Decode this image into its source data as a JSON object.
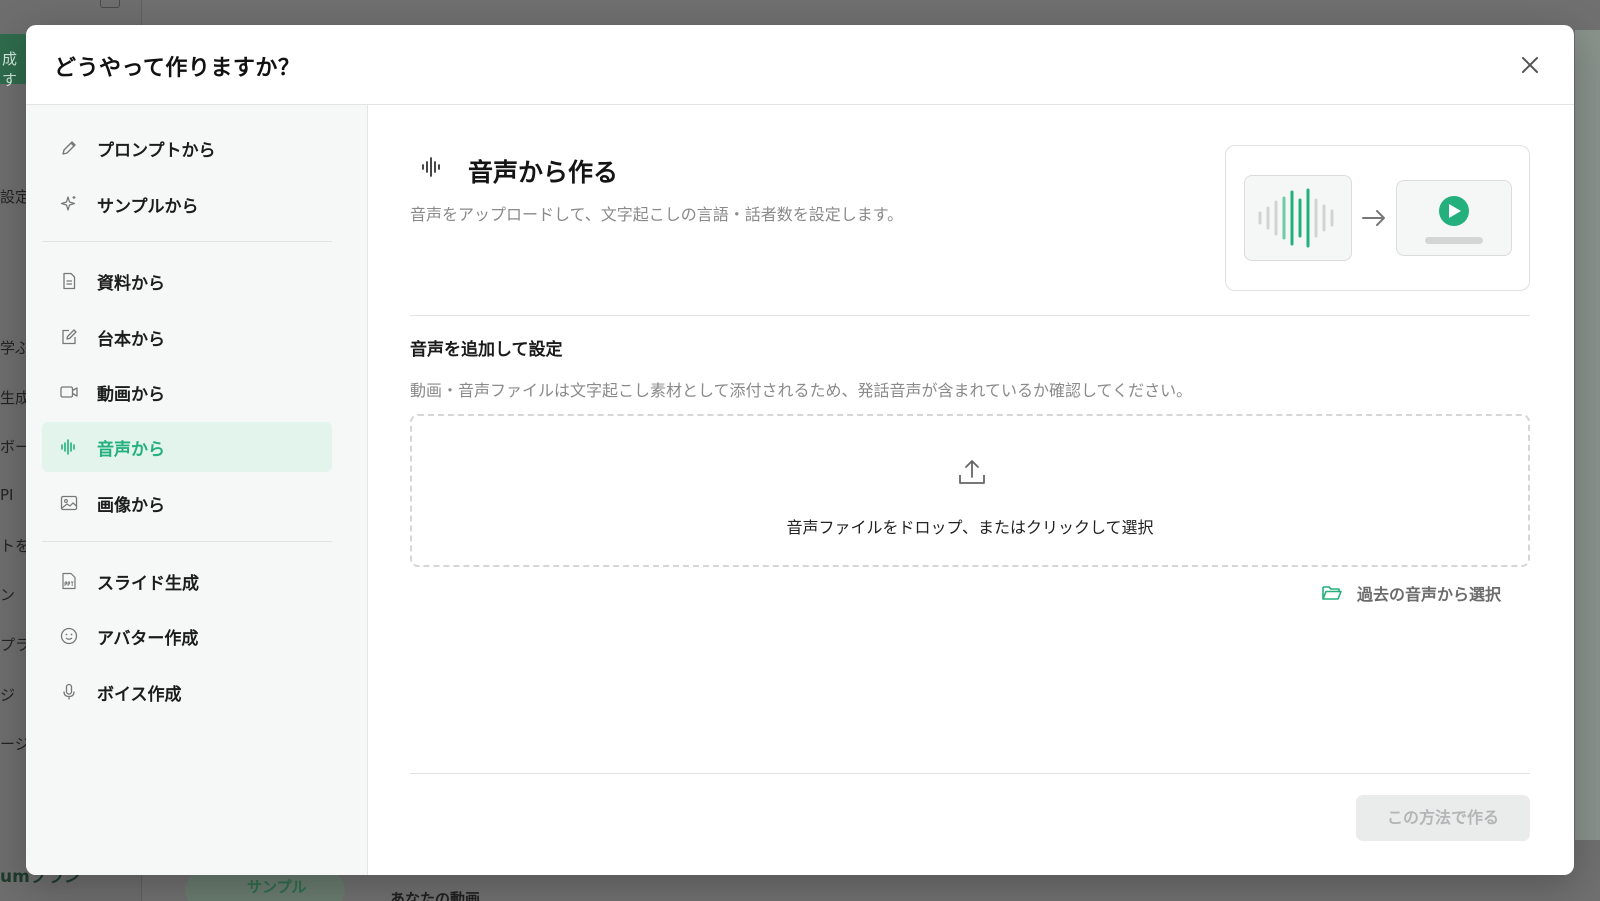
{
  "background": {
    "left_fragments": [
      "成す",
      "設定",
      "学ぶ",
      "生成",
      "ボー",
      "PI",
      "トを",
      "ン",
      "プラ",
      "ジ",
      "ージ"
    ],
    "bottom_left_text": "umプラン",
    "tab_label": "サンプル",
    "section_label": "あなたの動画"
  },
  "modal": {
    "title": "どうやって作りますか？",
    "close_icon": "close-icon"
  },
  "sidebar": {
    "groups": [
      [
        {
          "label": "プロンプトから",
          "icon": "pencil-icon"
        },
        {
          "label": "サンプルから",
          "icon": "sparkle-icon"
        }
      ],
      [
        {
          "label": "資料から",
          "icon": "document-icon"
        },
        {
          "label": "台本から",
          "icon": "edit-icon"
        },
        {
          "label": "動画から",
          "icon": "video-icon"
        },
        {
          "label": "音声から",
          "icon": "waveform-icon",
          "active": true
        },
        {
          "label": "画像から",
          "icon": "image-icon"
        }
      ],
      [
        {
          "label": "スライド生成",
          "icon": "ppt-icon"
        },
        {
          "label": "アバター作成",
          "icon": "smile-icon"
        },
        {
          "label": "ボイス作成",
          "icon": "microphone-icon"
        }
      ]
    ]
  },
  "content": {
    "title": "音声から作る",
    "description": "音声をアップロードして、文字起こしの言語・話者数を設定します。",
    "section_title": "音声を追加して設定",
    "section_note": "動画・音声ファイルは文字起こし素材として添付されるため、発話音声が含まれているか確認してください。",
    "dropzone_text": "音声ファイルをドロップ、またはクリックして選択",
    "past_link": "過去の音声から選択",
    "submit_label": "この方法で作る"
  },
  "colors": {
    "accent": "#23b07d",
    "active_bg": "#e2f4ec",
    "text_muted": "#8a8a8a",
    "disabled_bg": "#eaecec"
  }
}
